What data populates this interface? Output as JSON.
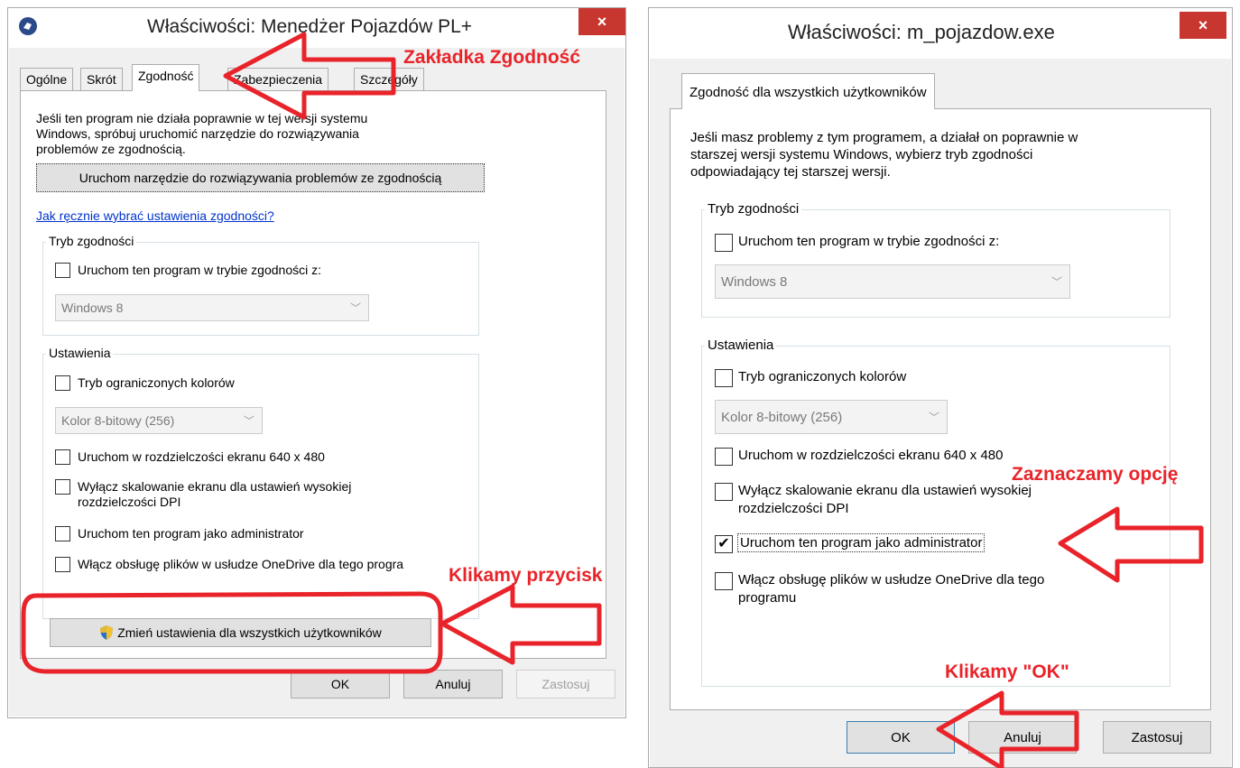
{
  "left": {
    "title": "Właściwości: Menedżer Pojazdów PL+",
    "close": "×",
    "tabs": [
      "Ogólne",
      "Skrót",
      "Zgodność",
      "Zabezpieczenia",
      "Szczegóły"
    ],
    "intro": [
      "Jeśli ten program nie działa poprawnie w tej wersji systemu",
      "Windows, spróbuj uruchomić narzędzie do rozwiązywania",
      "problemów ze zgodnością."
    ],
    "troubleshoot_button": "Uruchom narzędzie do rozwiązywania problemów ze zgodnością",
    "manual_link": "Jak ręcznie wybrać ustawienia zgodności?",
    "compat_group": "Tryb zgodności",
    "compat_check": "Uruchom ten program w trybie zgodności z:",
    "compat_select": "Windows 8",
    "settings_group": "Ustawienia",
    "opt_colors": "Tryb ograniczonych kolorów",
    "color_select": "Kolor 8-bitowy (256)",
    "opt_640": "Uruchom w rozdzielczości ekranu 640 x 480",
    "opt_dpi": [
      "Wyłącz skalowanie ekranu dla ustawień wysokiej",
      "rozdzielczości DPI"
    ],
    "opt_admin": "Uruchom ten program jako administrator",
    "opt_onedrive": "Włącz obsługę plików w usłudze OneDrive dla tego progra",
    "all_users_button": "Zmień ustawienia dla wszystkich użytkowników",
    "ok": "OK",
    "cancel": "Anuluj",
    "apply": "Zastosuj"
  },
  "right": {
    "title": "Właściwości: m_pojazdow.exe",
    "close": "×",
    "tab": "Zgodność dla wszystkich użytkowników",
    "intro": [
      "Jeśli masz problemy z tym programem, a działał on poprawnie w",
      "starszej wersji systemu Windows, wybierz tryb zgodności",
      "odpowiadający tej starszej wersji."
    ],
    "compat_group": "Tryb zgodności",
    "compat_check": "Uruchom ten program w trybie zgodności z:",
    "compat_select": "Windows 8",
    "settings_group": "Ustawienia",
    "opt_colors": "Tryb ograniczonych kolorów",
    "color_select": "Kolor 8-bitowy (256)",
    "opt_640": "Uruchom w rozdzielczości ekranu 640 x 480",
    "opt_dpi": [
      "Wyłącz skalowanie ekranu dla ustawień wysokiej",
      "rozdzielczości DPI"
    ],
    "opt_admin": "Uruchom ten program jako administrator",
    "opt_admin_mark": "✔",
    "opt_onedrive": [
      "Włącz obsługę plików w usłudze OneDrive dla tego",
      "programu"
    ],
    "ok": "OK",
    "cancel": "Anuluj",
    "apply": "Zastosuj"
  },
  "annotations": {
    "tab_note": "Zakładka Zgodność",
    "click_button": "Klikamy przycisk",
    "check_option": "Zaznaczamy opcję",
    "click_ok": "Klikamy \"OK\""
  },
  "colors": {
    "annotation": "#e8242a",
    "close": "#c7372f"
  }
}
